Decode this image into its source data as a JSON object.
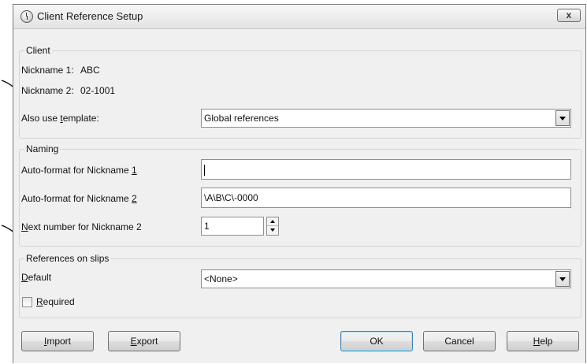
{
  "dialog": {
    "title": "Client Reference Setup",
    "close_label": "x"
  },
  "client": {
    "legend": "Client",
    "nickname1_label": "Nickname 1:",
    "nickname1_value": "ABC",
    "nickname2_label": "Nickname 2:",
    "nickname2_value": "02-1001",
    "template_label_pre": "Also use ",
    "template_label_u": "t",
    "template_label_post": "emplate:",
    "template_value": "Global references"
  },
  "naming": {
    "legend": "Naming",
    "autofmt1_pre": "Auto-format for Nickname ",
    "autofmt1_u": "1",
    "autofmt1_value": "",
    "autofmt2_pre": "Auto-format for Nickname ",
    "autofmt2_u": "2",
    "autofmt2_value": "\\A\\B\\C\\-0000",
    "next_u": "N",
    "next_post": "ext number for Nickname 2",
    "next_value": "1"
  },
  "slips": {
    "legend": "References on slips",
    "default_u": "D",
    "default_post": "efault",
    "default_value": "<None>",
    "required_u": "R",
    "required_post": "equired",
    "required_checked": false
  },
  "buttons": {
    "import_u": "I",
    "import_post": "mport",
    "export_u": "E",
    "export_post": "xport",
    "ok": "OK",
    "cancel": "Cancel",
    "help_u": "H",
    "help_post": "elp"
  }
}
